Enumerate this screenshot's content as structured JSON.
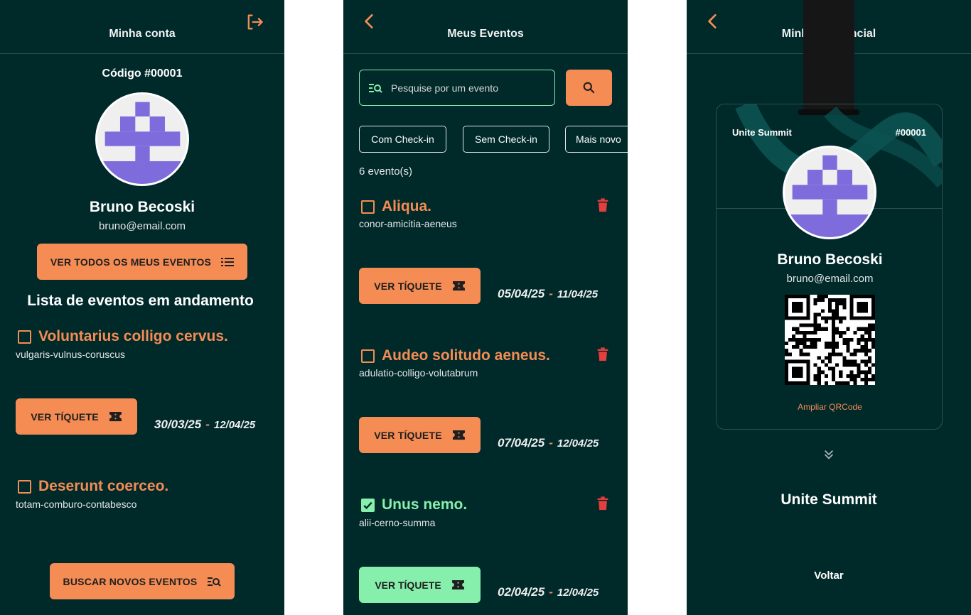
{
  "account": {
    "title": "Minha conta",
    "code": "Código #00001",
    "name": "Bruno Becoski",
    "email": "bruno@email.com",
    "all_events_label": "VER TODOS OS MEUS EVENTOS",
    "section_title": "Lista de eventos em andamento",
    "events": [
      {
        "title": "Voluntarius colligo cervus.",
        "slug": "vulgaris-vulnus-coruscus",
        "ticket_label": "VER TÍQUETE",
        "start": "30/03/25",
        "end": "12/04/25"
      },
      {
        "title": "Deserunt coerceo.",
        "slug": "totam-comburo-contabesco"
      }
    ],
    "search_new_label": "BUSCAR NOVOS EVENTOS"
  },
  "my_events": {
    "title": "Meus Eventos",
    "search_placeholder": "Pesquise por um evento",
    "filters": [
      "Com Check-in",
      "Sem Check-in",
      "Mais novo"
    ],
    "count_text": "6 evento(s)",
    "events": [
      {
        "title": "Aliqua.",
        "slug": "conor-amicitia-aeneus",
        "ticket_label": "VER TÍQUETE",
        "start": "05/04/25",
        "end": "11/04/25",
        "checked_in": false
      },
      {
        "title": "Audeo solitudo aeneus.",
        "slug": "adulatio-colligo-volutabrum",
        "ticket_label": "VER TÍQUETE",
        "start": "07/04/25",
        "end": "12/04/25",
        "checked_in": false
      },
      {
        "title": "Unus nemo.",
        "slug": "alii-cerno-summa",
        "ticket_label": "VER TÍQUETE",
        "start": "02/04/25",
        "end": "12/04/25",
        "checked_in": true
      }
    ]
  },
  "credential": {
    "title": "Minha Credencial",
    "event_name": "Unite Summit",
    "badge_code": "#00001",
    "name": "Bruno Becoski",
    "email": "bruno@email.com",
    "enlarge_qr": "Ampliar QRCode",
    "footer_event": "Unite Summit",
    "back_label": "Voltar"
  },
  "colors": {
    "background": "#00292a",
    "accent_orange": "#f48c54",
    "accent_green": "#86efac",
    "avatar_purple": "#7e6cdc",
    "danger": "#e53e3e"
  },
  "icons": [
    "logout-icon",
    "back-icon",
    "list-icon",
    "ticket-icon",
    "search-list-icon",
    "search-icon",
    "trash-icon",
    "checkbox-icon",
    "chevron-double-down-icon"
  ]
}
